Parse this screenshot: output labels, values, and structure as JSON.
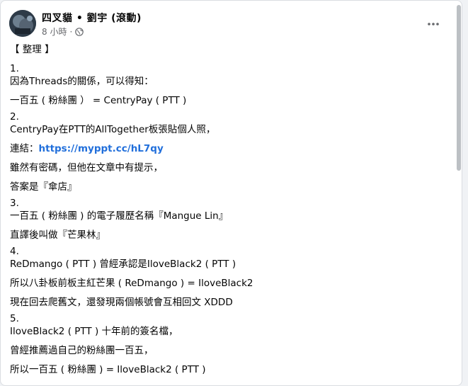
{
  "post": {
    "author": "四叉貓 • 劉宇 (滾動)",
    "time": "8 小時",
    "separator": "·",
    "body": {
      "l1": "【 整理 】",
      "l2": "1.",
      "l3": "因為Threads的關係，可以得知：",
      "l4": "一百五 ( 粉絲團 ） = CentryPay ( PTT )",
      "l5": "2.",
      "l6": "CentryPay在PTT的AllTogether板張貼個人照，",
      "l7_prefix": "連結：",
      "l7_link": "https://myppt.cc/hL7qy",
      "l8": "雖然有密碼，但他在文章中有提示，",
      "l9": "答案是『傘店』",
      "l10": "3.",
      "l11": "一百五 ( 粉絲團 ) 的電子履歷名稱『Mangue Lin』",
      "l12": "直譯後叫做『芒果林』",
      "l13": "4.",
      "l14": "ReDmango ( PTT ) 曾經承認是IloveBlack2 ( PTT )",
      "l15": "所以八卦板前板主紅芒果 ( ReDmango ) = IloveBlack2",
      "l16": "現在回去爬舊文，還發現兩個帳號會互相回文 XDDD",
      "l17": "5.",
      "l18": "IloveBlack2 ( PTT ) 十年前的簽名檔，",
      "l19": "曾經推薦過自己的粉絲團一百五，",
      "l20": "所以一百五 ( 粉絲團 ) = IloveBlack2 ( PTT )"
    }
  },
  "icons": {
    "avatar": "avatar-photo",
    "globe": "globe-icon",
    "more": "more-options-icon"
  },
  "colors": {
    "link": "#216fdb",
    "meta": "#65676b",
    "text": "#050505"
  }
}
